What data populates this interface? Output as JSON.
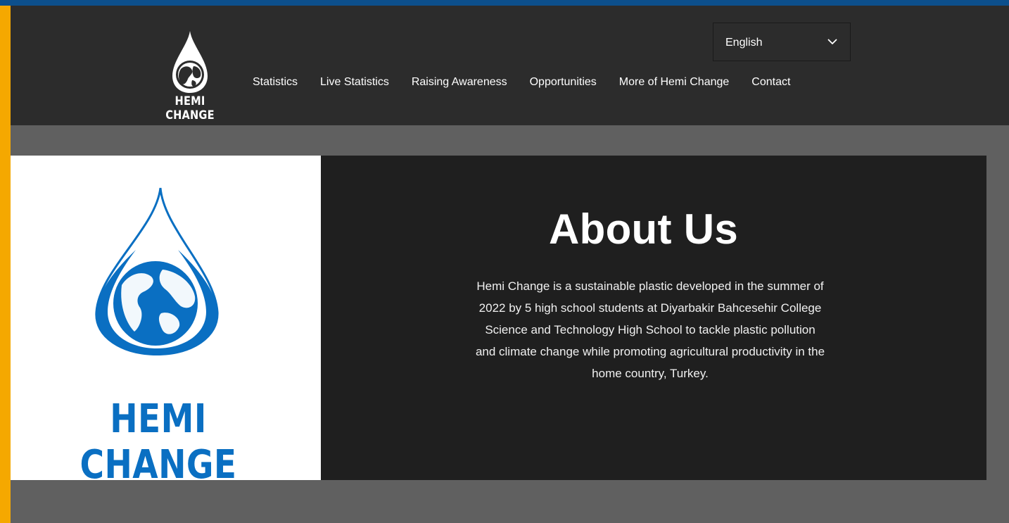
{
  "site": {
    "logo_text": "HEMI CHANGE"
  },
  "header": {
    "language": {
      "selected": "English",
      "icon": "chevron-down-icon"
    },
    "nav": [
      {
        "label": "Statistics"
      },
      {
        "label": "Live Statistics"
      },
      {
        "label": "Raising Awareness"
      },
      {
        "label": "Opportunities"
      },
      {
        "label": "More of Hemi Change"
      },
      {
        "label": "Contact"
      }
    ]
  },
  "about": {
    "brand_text": "HEMI CHANGE",
    "title": "About Us",
    "body": "Hemi Change is a sustainable plastic developed in the summer of 2022 by 5 high school students at Diyarbakir Bahcesehir College Science and Technology High School to tackle plastic pollution and climate change while promoting agricultural productivity in the home country, Turkey."
  },
  "colors": {
    "brand_blue": "#0a6fc2",
    "header_bg": "#2c2c2c",
    "panel_bg": "#1f1f1f",
    "page_bg": "#606060",
    "frame_blue": "#0c4f8c",
    "frame_orange": "#f5a800"
  }
}
